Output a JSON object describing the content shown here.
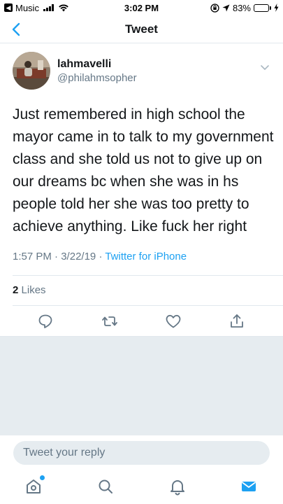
{
  "status_bar": {
    "back_app": "Music",
    "time": "3:02 PM",
    "battery": "83%",
    "battery_level": 0.83
  },
  "nav": {
    "title": "Tweet"
  },
  "tweet": {
    "display_name": "lahmavelli",
    "handle": "@philahmsopher",
    "text": "Just remembered in high school the mayor came in to talk to my government class and she told us not to give up on our dreams bc when she was in hs people told her she was too pretty to achieve anything. Like fuck her right",
    "time": "1:57 PM",
    "date": "3/22/19",
    "separator": "·",
    "source": "Twitter for iPhone",
    "likes_count": "2",
    "likes_label": "Likes"
  },
  "reply": {
    "placeholder": "Tweet your reply"
  },
  "colors": {
    "accent": "#1da1f2",
    "text": "#14171a",
    "secondary": "#657786",
    "background_gray": "#e6ecf0"
  },
  "icons": {
    "actions": [
      "reply-icon",
      "retweet-icon",
      "like-icon",
      "share-icon"
    ],
    "tabs": [
      "home-icon",
      "search-icon",
      "notifications-icon",
      "messages-icon"
    ]
  }
}
